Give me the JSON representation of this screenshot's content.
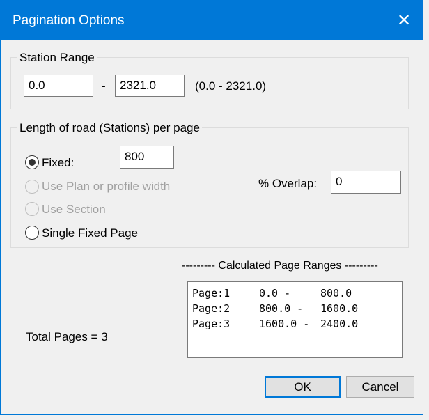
{
  "dialog": {
    "title": "Pagination Options",
    "close_glyph": "✕"
  },
  "station_range": {
    "legend": "Station Range",
    "from": "0.0",
    "dash": "-",
    "to": "2321.0",
    "range_hint": "(0.0 - 2321.0)"
  },
  "length_group": {
    "legend": "Length of road (Stations) per page",
    "options": [
      {
        "label": "Fixed:",
        "selected": true,
        "enabled": true
      },
      {
        "label": "Use Plan or profile width",
        "selected": false,
        "enabled": false
      },
      {
        "label": "Use Section",
        "selected": false,
        "enabled": false
      },
      {
        "label": "Single Fixed Page",
        "selected": false,
        "enabled": true
      }
    ],
    "fixed_value": "800",
    "overlap_label": "% Overlap:",
    "overlap_value": "0"
  },
  "calculated": {
    "header": "--------- Calculated Page Ranges ---------",
    "rows": [
      {
        "page": "Page:1",
        "start": "0.0  -",
        "end": "800.0"
      },
      {
        "page": "Page:2",
        "start": "800.0  -",
        "end": "1600.0"
      },
      {
        "page": "Page:3",
        "start": "1600.0  -",
        "end": "2400.0"
      }
    ]
  },
  "total_pages_label": "Total Pages =  3",
  "buttons": {
    "ok": "OK",
    "cancel": "Cancel"
  },
  "colors": {
    "accent": "#0078d7",
    "background": "#f0f0f0",
    "disabled_text": "#a0a0a0"
  }
}
